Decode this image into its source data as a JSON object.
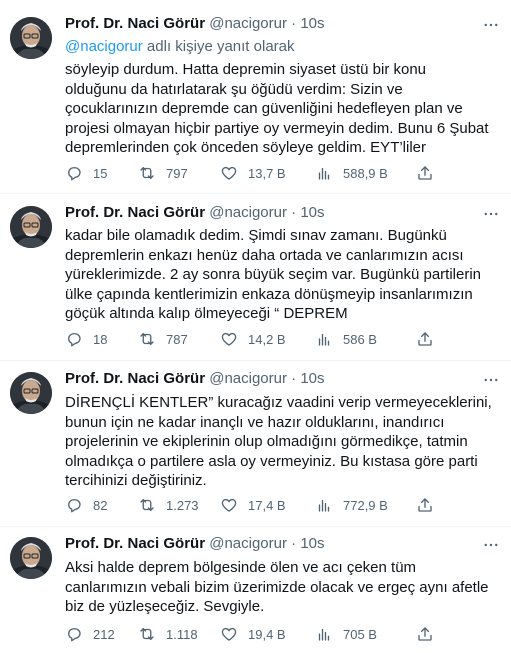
{
  "tweets": [
    {
      "author": "Prof. Dr. Naci Görür",
      "handle": "@nacigorur",
      "dot": "·",
      "time": "10s",
      "reply_mention": "@nacigorur",
      "reply_suffix": " adlı kişiye yanıt olarak",
      "text": "söyleyip durdum. Hatta depremin siyaset üstü bir konu\nolduğunu da hatırlatarak şu öğüdü verdim: Sizin ve\nçocuklarınızın depremde can güvenliğini hedefleyen  plan ve\nprojesi olmayan hiçbir partiye oy vermeyin dedim. Bunu 6 Şubat\ndepremlerinden çok önceden söyleye geldim. EYT’liler",
      "replies": "15",
      "retweets": "797",
      "likes": "13,7 B",
      "views": "588,9 B"
    },
    {
      "author": "Prof. Dr. Naci Görür",
      "handle": "@nacigorur",
      "dot": "·",
      "time": "10s",
      "text": "kadar bile olamadık dedim. Şimdi sınav zamanı. Bugünkü\ndepremlerin enkazı henüz daha ortada ve canlarımızın acısı\nyüreklerimizde. 2 ay sonra büyük seçim var. Bugünkü partilerin\nülke çapında kentlerimizin enkaza dönüşmeyip insanlarımızın\ngöçük altında kalıp ölmeyeceği “ DEPREM",
      "replies": "18",
      "retweets": "787",
      "likes": "14,2 B",
      "views": "586 B"
    },
    {
      "author": "Prof. Dr. Naci Görür",
      "handle": "@nacigorur",
      "dot": "·",
      "time": "10s",
      "text": "DİRENÇLİ KENTLER” kuracağız vaadini verip vermeyeceklerini,\nbunun için ne kadar inançlı ve hazır olduklarını, inandırıcı\nprojelerinin ve ekiplerinin olup olmadığını görmedikçe, tatmin\nolmadıkça o partilere asla oy vermeyiniz. Bu kıstasa göre parti\ntercihinizi değiştiriniz.",
      "replies": "82",
      "retweets": "1.273",
      "likes": "17,4 B",
      "views": "772,9 B"
    },
    {
      "author": "Prof. Dr. Naci Görür",
      "handle": "@nacigorur",
      "dot": "·",
      "time": "10s",
      "text": "Aksi halde deprem bölgesinde ölen ve acı çeken tüm\ncanlarımızın vebali bizim üzerimizde olacak ve ergeç aynı afetle\nbiz de yüzleşeceğiz. Sevgiyle.",
      "replies": "212",
      "retweets": "1.118",
      "likes": "19,4 B",
      "views": "705 B"
    }
  ]
}
